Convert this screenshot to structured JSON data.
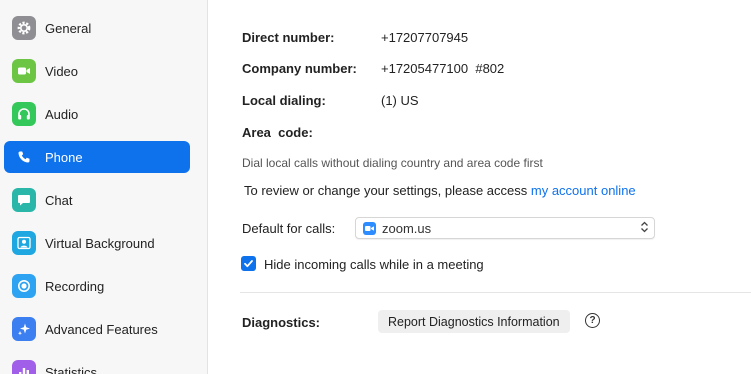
{
  "sidebar": {
    "items": [
      {
        "label": "General",
        "icon": "gear-icon",
        "color": "#8e8e93",
        "active": false
      },
      {
        "label": "Video",
        "icon": "video-camera-icon",
        "color": "#6cc644",
        "active": false
      },
      {
        "label": "Audio",
        "icon": "headphones-icon",
        "color": "#34c759",
        "active": false
      },
      {
        "label": "Phone",
        "icon": "phone-icon",
        "color": "#0e72ed",
        "active": true
      },
      {
        "label": "Chat",
        "icon": "chat-bubble-icon",
        "color": "#2ab7a9",
        "active": false
      },
      {
        "label": "Virtual Background",
        "icon": "person-icon",
        "color": "#1ea7e0",
        "active": false
      },
      {
        "label": "Recording",
        "icon": "record-icon",
        "color": "#2ea3f2",
        "active": false
      },
      {
        "label": "Advanced Features",
        "icon": "sparkle-icon",
        "color": "#3b7ff0",
        "active": false
      },
      {
        "label": "Statistics",
        "icon": "bar-chart-icon",
        "color": "#a15ee8",
        "active": false
      }
    ]
  },
  "phone": {
    "direct_number_label": "Direct number:",
    "direct_number_value": "+17207707945",
    "company_number_label": "Company number:",
    "company_number_value": "+17205477100  #802",
    "local_dialing_label": "Local dialing:",
    "local_dialing_value": "(1) US",
    "area_code_label": "Area  code:",
    "hint": "Dial local calls without dialing country and area code first",
    "review_text": "To review or change your settings, please access ",
    "review_link": "my account online",
    "default_calls_label": "Default for calls:",
    "default_calls_value": "zoom.us",
    "hide_incoming_label": "Hide incoming calls while in a meeting",
    "hide_incoming_checked": true,
    "diagnostics_label": "Diagnostics:",
    "diagnostics_button": "Report Diagnostics Information",
    "help_glyph": "?"
  },
  "colors": {
    "accent": "#0e72ed",
    "sidebar_bg": "#f7f7f7"
  }
}
